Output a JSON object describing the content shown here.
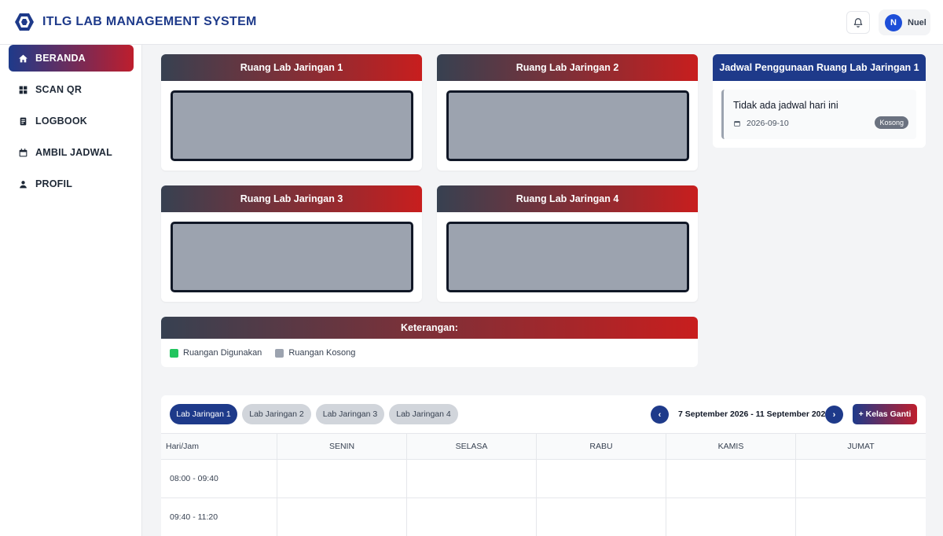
{
  "header": {
    "app_title": "ITLG LAB MANAGEMENT SYSTEM",
    "user_initial": "N",
    "user_name": "Nuel"
  },
  "sidebar": {
    "items": [
      {
        "label": "BERANDA",
        "icon": "home-icon",
        "active": true
      },
      {
        "label": "SCAN QR",
        "icon": "grid-icon",
        "active": false
      },
      {
        "label": "LOGBOOK",
        "icon": "logbook-icon",
        "active": false
      },
      {
        "label": "AMBIL JADWAL",
        "icon": "calendar-icon",
        "active": false
      },
      {
        "label": "PROFIL",
        "icon": "person-icon",
        "active": false
      }
    ]
  },
  "rooms": [
    {
      "name": "Ruang Lab Jaringan 1",
      "status": "kosong"
    },
    {
      "name": "Ruang Lab Jaringan 2",
      "status": "kosong"
    },
    {
      "name": "Ruang Lab Jaringan 3",
      "status": "kosong"
    },
    {
      "name": "Ruang Lab Jaringan 4",
      "status": "kosong"
    }
  ],
  "legend": {
    "title": "Keterangan:",
    "items": [
      {
        "label": "Ruangan Digunakan",
        "color": "#22c55e"
      },
      {
        "label": "Ruangan Kosong",
        "color": "#9ca3af"
      }
    ]
  },
  "schedule_panel": {
    "title": "Jadwal Penggunaan Ruang Lab Jaringan 1",
    "message": "Tidak ada jadwal hari ini",
    "date": "2026-09-10",
    "badge": "Kosong"
  },
  "timetable": {
    "tabs": [
      "Lab Jaringan 1",
      "Lab Jaringan 2",
      "Lab Jaringan 3",
      "Lab Jaringan 4"
    ],
    "active_tab": 0,
    "prev_label": "‹",
    "next_label": "›",
    "week_range": "7 September 2026 - 11 September 2026",
    "kelas_ganti_label": "+ Kelas Ganti",
    "columns": [
      "Hari/Jam",
      "SENIN",
      "SELASA",
      "RABU",
      "KAMIS",
      "JUMAT"
    ],
    "rows": [
      "08:00 - 09:40",
      "09:40 - 11:20"
    ]
  },
  "colors": {
    "primary": "#1e3a8a",
    "accent": "#be1e2d",
    "room_empty": "#9ca3af",
    "room_used": "#22c55e"
  }
}
